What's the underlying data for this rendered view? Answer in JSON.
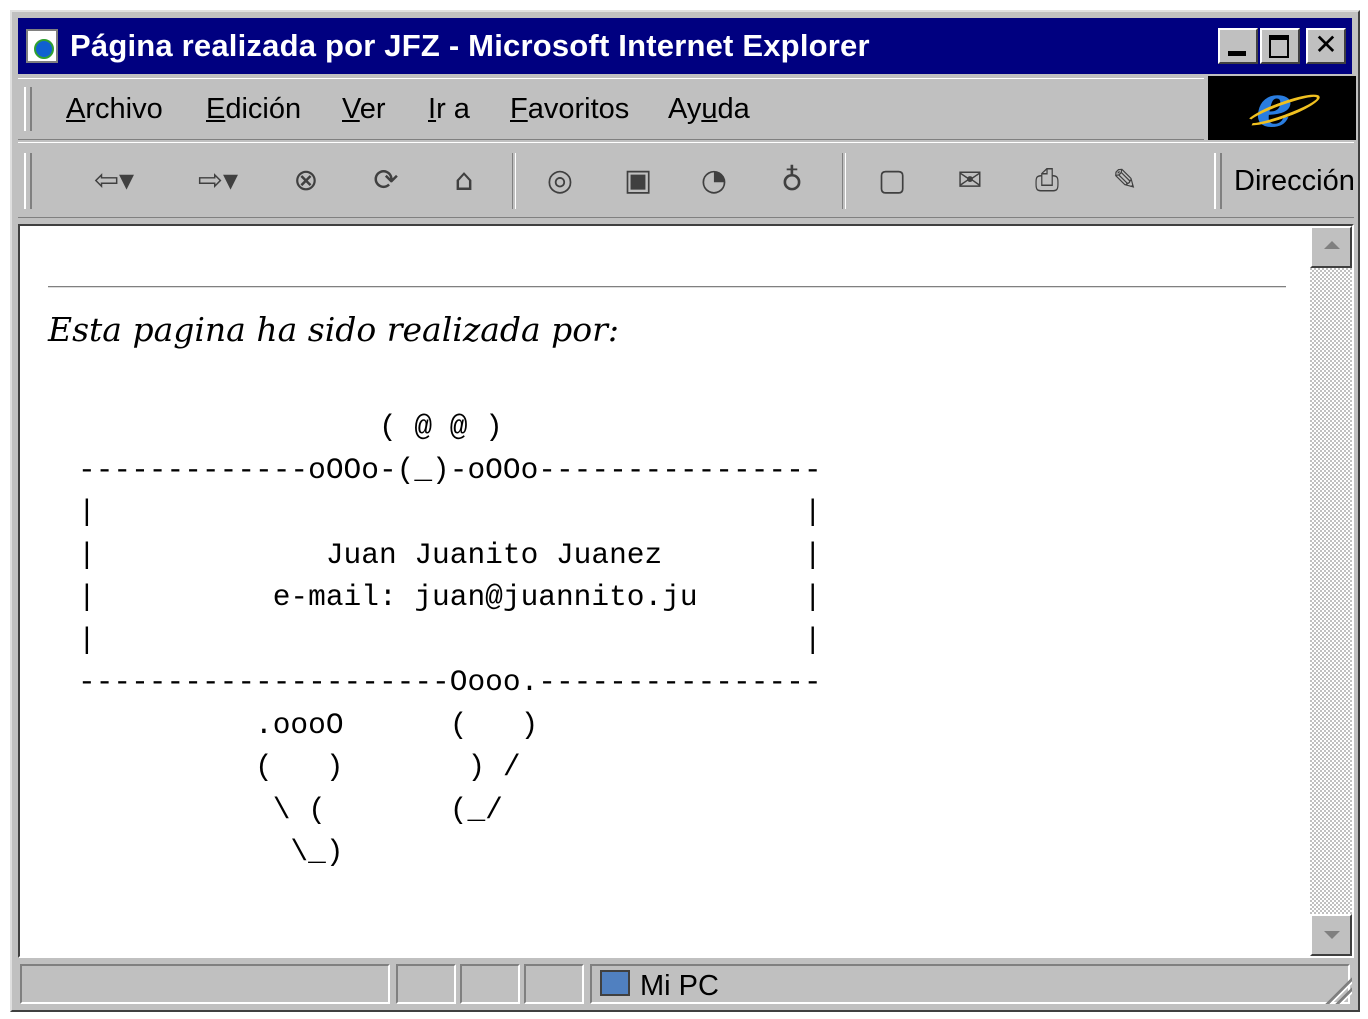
{
  "window": {
    "title": "Página realizada por JFZ - Microsoft Internet Explorer"
  },
  "menu": {
    "items": [
      {
        "pre": "",
        "key": "A",
        "post": "rchivo"
      },
      {
        "pre": "",
        "key": "E",
        "post": "dición"
      },
      {
        "pre": "",
        "key": "V",
        "post": "er"
      },
      {
        "pre": "",
        "key": "I",
        "post": "r a"
      },
      {
        "pre": "",
        "key": "F",
        "post": "avoritos"
      },
      {
        "pre": "Ay",
        "key": "u",
        "post": "da"
      }
    ]
  },
  "toolbar": {
    "buttons": [
      "back-icon",
      "forward-icon",
      "stop-icon",
      "refresh-icon",
      "home-icon",
      "search-icon",
      "favorites-icon",
      "history-icon",
      "channels-icon",
      "fullscreen-icon",
      "mail-icon",
      "print-icon",
      "edit-icon"
    ],
    "address_label": "Dirección"
  },
  "page": {
    "intro": "Esta pagina ha sido realizada por:",
    "ascii_art": "                 ( @ @ )\n-------------oOOo-(_)-oOOo----------------\n|                                        |\n|             Juan Juanito Juanez        |\n|          e-mail: juan@juannito.ju      |\n|                                        |\n---------------------Oooo.----------------\n          .oooO      (   )\n          (   )       ) /\n           \\ (       (_/\n            \\_)"
  },
  "status": {
    "zone": "Mi PC"
  },
  "colors": {
    "titlebar": "#000080",
    "chrome": "#c0c0c0",
    "ie_logo_bg": "#000000"
  }
}
